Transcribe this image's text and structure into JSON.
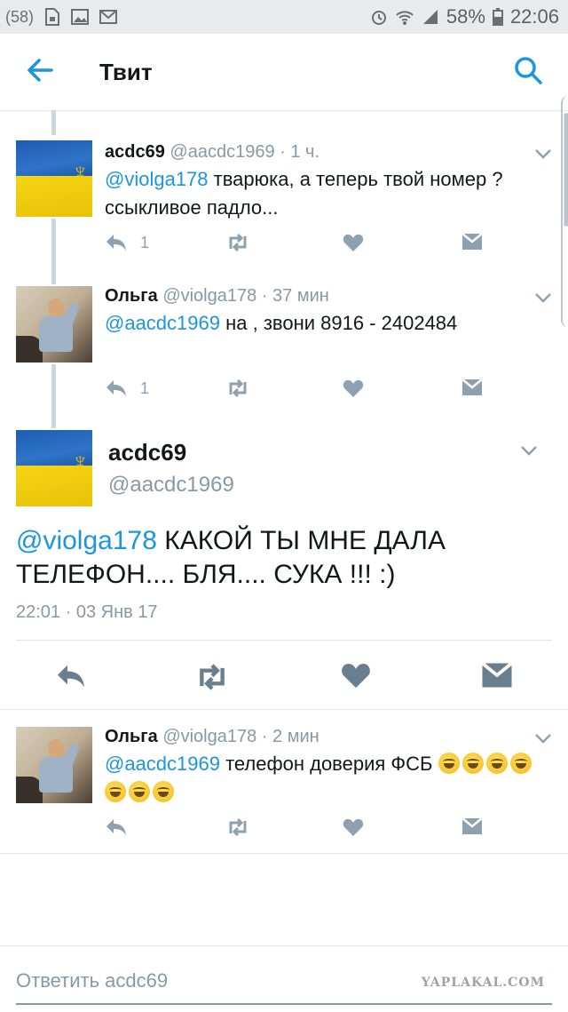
{
  "status_bar": {
    "left_icons": [
      "notification-badge-icon",
      "sim-icon",
      "image-icon",
      "mail-icon"
    ],
    "notification_count": "58",
    "battery": "58%",
    "time": "22:06"
  },
  "header": {
    "title": "Твит"
  },
  "tweets": [
    {
      "name": "acdc69",
      "handle": "@aacdc1969",
      "time": "· 1 ч.",
      "mention": "@violga178",
      "text": " тварюка, а теперь твой номер ? ссыкливое падло...",
      "reply_count": "1"
    },
    {
      "name": "Ольга",
      "handle": "@violga178",
      "time": "· 37 мин",
      "mention": "@aacdc1969",
      "text": " на , звони 8916 - 2402484",
      "reply_count": "1"
    }
  ],
  "main_tweet": {
    "name": "acdc69",
    "handle": "@aacdc1969",
    "mention": "@violga178",
    "text": " КАКОЙ ТЫ МНЕ ДАЛА ТЕЛЕФОН.... БЛЯ.... СУКА !!! :)",
    "timestamp": "22:01 · 03 Янв 17"
  },
  "reply_tweet": {
    "name": "Ольга",
    "handle": "@violga178",
    "time": "· 2 мин",
    "mention": "@aacdc1969",
    "text": " телефон доверия ФСБ",
    "emoji_name": "laughing-emoji",
    "emoji_count": 7
  },
  "reply_bar": {
    "placeholder": "Ответить acdc69"
  },
  "watermark": "YAPLAKAL.COM",
  "colors": {
    "accent": "#1b95e0",
    "muted": "#8899a6",
    "action_icon": "#8ea1b0",
    "main_action_icon": "#697f90"
  }
}
